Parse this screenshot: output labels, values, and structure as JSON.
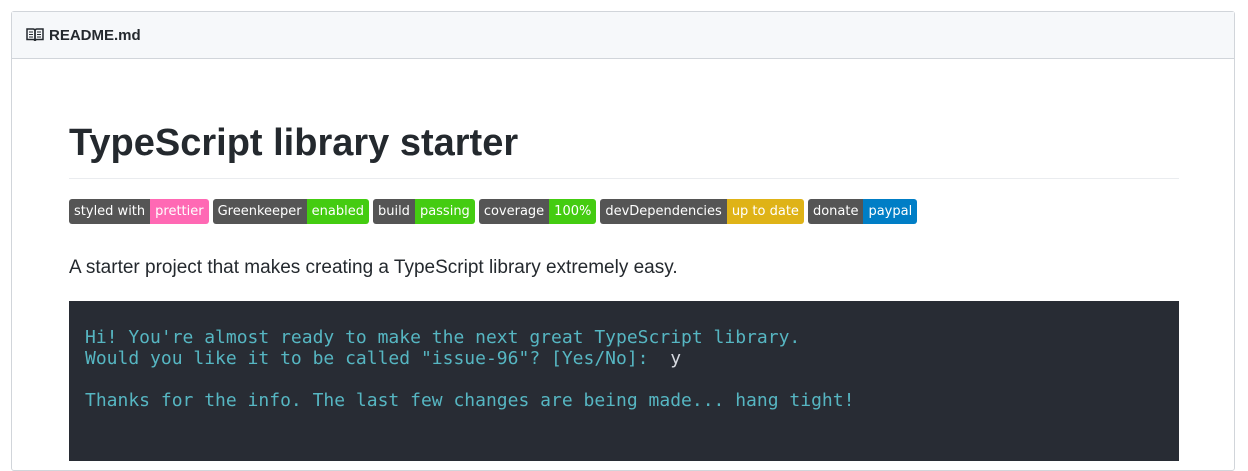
{
  "readme": {
    "filename": "README.md",
    "icon": "book-icon"
  },
  "content": {
    "title": "TypeScript library starter",
    "description": "A starter project that makes creating a TypeScript library extremely easy."
  },
  "badges": [
    {
      "label": "styled with",
      "value": "prettier",
      "color": "#ff69b4"
    },
    {
      "label": "Greenkeeper",
      "value": "enabled",
      "color": "#44cc11"
    },
    {
      "label": "build",
      "value": "passing",
      "color": "#44cc11"
    },
    {
      "label": "coverage",
      "value": "100%",
      "color": "#44cc11"
    },
    {
      "label": "devDependencies",
      "value": "up to date",
      "color": "#dfb317"
    },
    {
      "label": "donate",
      "value": "paypal",
      "color": "#007ec6"
    }
  ],
  "terminal": {
    "line1": "Hi! You're almost ready to make the next great TypeScript library.",
    "line2_prompt": "Would you like it to be called \"issue-96\"? [Yes/No]:  ",
    "line2_answer": "y",
    "line3": "Thanks for the info. The last few changes are being made... hang tight!",
    "background": "#282c34",
    "text_color": "#56b6c2"
  }
}
